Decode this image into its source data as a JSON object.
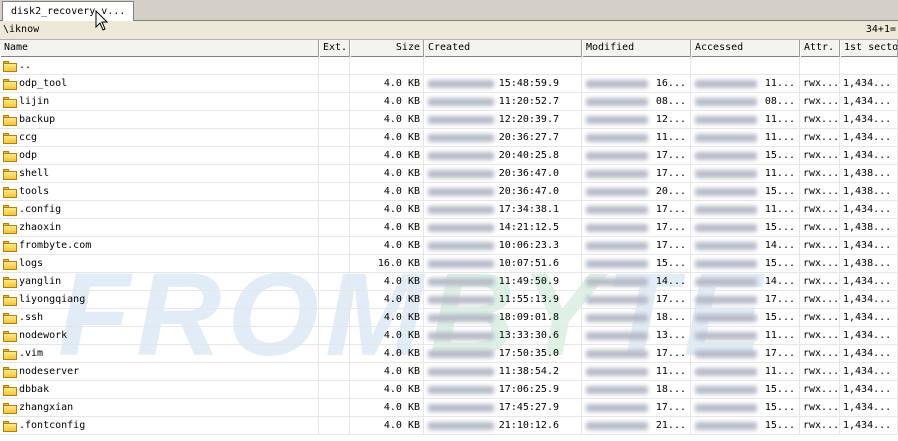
{
  "tab": {
    "label": "disk2_recovery_v..."
  },
  "pathbar": {
    "path": "\\iknow",
    "count": "34+1="
  },
  "columns": {
    "name": "Name",
    "ext": "Ext.",
    "size": "Size",
    "created": "Created",
    "modified": "Modified",
    "accessed": "Accessed",
    "attr": "Attr.",
    "sector": "1st secto"
  },
  "rows": [
    {
      "name": "..",
      "size": "",
      "created_time": "",
      "modified": "",
      "accessed": "",
      "attr": "",
      "sector": ""
    },
    {
      "name": "odp_tool",
      "size": "4.0 KB",
      "created_time": "15:48:59.9",
      "modified": "16...",
      "accessed": "11...",
      "attr": "rwx...",
      "sector": "1,434..."
    },
    {
      "name": "lijin",
      "size": "4.0 KB",
      "created_time": "11:20:52.7",
      "modified": "08...",
      "accessed": "08...",
      "attr": "rwx...",
      "sector": "1,434..."
    },
    {
      "name": "backup",
      "size": "4.0 KB",
      "created_time": "12:20:39.7",
      "modified": "12...",
      "accessed": "11...",
      "attr": "rwx...",
      "sector": "1,434..."
    },
    {
      "name": "ccg",
      "size": "4.0 KB",
      "created_time": "20:36:27.7",
      "modified": "11...",
      "accessed": "11...",
      "attr": "rwx...",
      "sector": "1,434..."
    },
    {
      "name": "odp",
      "size": "4.0 KB",
      "created_time": "20:40:25.8",
      "modified": "17...",
      "accessed": "15...",
      "attr": "rwx...",
      "sector": "1,434..."
    },
    {
      "name": "shell",
      "size": "4.0 KB",
      "created_time": "20:36:47.0",
      "modified": "17...",
      "accessed": "11...",
      "attr": "rwx...",
      "sector": "1,438..."
    },
    {
      "name": "tools",
      "size": "4.0 KB",
      "created_time": "20:36:47.0",
      "modified": "20...",
      "accessed": "15...",
      "attr": "rwx...",
      "sector": "1,438..."
    },
    {
      "name": ".config",
      "size": "4.0 KB",
      "created_time": "17:34:38.1",
      "modified": "17...",
      "accessed": "11...",
      "attr": "rwx...",
      "sector": "1,434..."
    },
    {
      "name": "zhaoxin",
      "size": "4.0 KB",
      "created_time": "14:21:12.5",
      "modified": "17...",
      "accessed": "15...",
      "attr": "rwx...",
      "sector": "1,438..."
    },
    {
      "name": "frombyte.com",
      "size": "4.0 KB",
      "created_time": "10:06:23.3",
      "modified": "17...",
      "accessed": "14...",
      "attr": "rwx...",
      "sector": "1,434..."
    },
    {
      "name": "logs",
      "size": "16.0 KB",
      "created_time": "10:07:51.6",
      "modified": "15...",
      "accessed": "15...",
      "attr": "rwx...",
      "sector": "1,438..."
    },
    {
      "name": "yanglin",
      "size": "4.0 KB",
      "created_time": "11:49:50.9",
      "modified": "14...",
      "accessed": "14...",
      "attr": "rwx...",
      "sector": "1,434..."
    },
    {
      "name": "liyongqiang",
      "size": "4.0 KB",
      "created_time": "11:55:13.9",
      "modified": "17...",
      "accessed": "17...",
      "attr": "rwx...",
      "sector": "1,434..."
    },
    {
      "name": ".ssh",
      "size": "4.0 KB",
      "created_time": "18:09:01.8",
      "modified": "18...",
      "accessed": "15...",
      "attr": "rwx...",
      "sector": "1,434..."
    },
    {
      "name": "nodework",
      "size": "4.0 KB",
      "created_time": "13:33:30.6",
      "modified": "13...",
      "accessed": "11...",
      "attr": "rwx...",
      "sector": "1,434..."
    },
    {
      "name": ".vim",
      "size": "4.0 KB",
      "created_time": "17:50:35.0",
      "modified": "17...",
      "accessed": "17...",
      "attr": "rwx...",
      "sector": "1,434..."
    },
    {
      "name": "nodeserver",
      "size": "4.0 KB",
      "created_time": "11:38:54.2",
      "modified": "11...",
      "accessed": "11...",
      "attr": "rwx...",
      "sector": "1,434..."
    },
    {
      "name": "dbbak",
      "size": "4.0 KB",
      "created_time": "17:06:25.9",
      "modified": "18...",
      "accessed": "15...",
      "attr": "rwx...",
      "sector": "1,434..."
    },
    {
      "name": "zhangxian",
      "size": "4.0 KB",
      "created_time": "17:45:27.9",
      "modified": "17...",
      "accessed": "15...",
      "attr": "rwx...",
      "sector": "1,434..."
    },
    {
      "name": ".fontconfig",
      "size": "4.0 KB",
      "created_time": "21:10:12.6",
      "modified": "21...",
      "accessed": "15...",
      "attr": "rwx...",
      "sector": "1,434..."
    }
  ],
  "watermark": {
    "left": "FROM",
    "mid": "BY",
    "right": "TE"
  },
  "colors": {
    "folder": "#f3c53a",
    "header_bg": "#f4f3ee",
    "tabbar_bg": "#d4d0c8"
  }
}
